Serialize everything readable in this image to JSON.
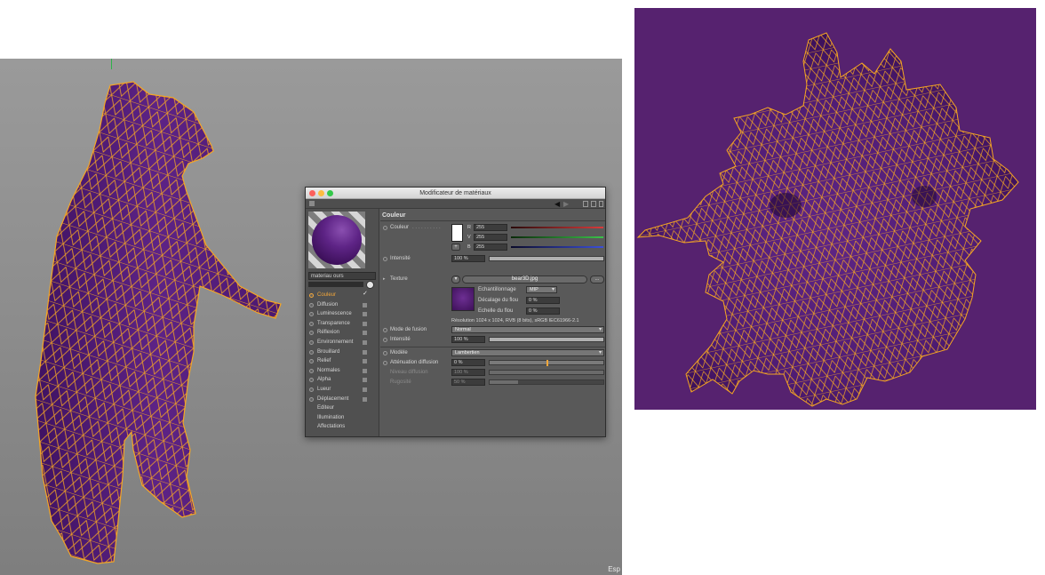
{
  "viewport": {
    "corner_label": "Esp"
  },
  "material_editor": {
    "title": "Modificateur de matériaux",
    "material_name": "materiau ours",
    "channels": [
      {
        "label": "Couleur",
        "active": true,
        "enabled": true
      },
      {
        "label": "Diffusion",
        "active": false,
        "enabled": false
      },
      {
        "label": "Luminescence",
        "active": false,
        "enabled": false
      },
      {
        "label": "Transparence",
        "active": false,
        "enabled": false
      },
      {
        "label": "Réflexion",
        "active": false,
        "enabled": false
      },
      {
        "label": "Environnement",
        "active": false,
        "enabled": false
      },
      {
        "label": "Brouillard",
        "active": false,
        "enabled": false
      },
      {
        "label": "Relief",
        "active": false,
        "enabled": false
      },
      {
        "label": "Normales",
        "active": false,
        "enabled": false
      },
      {
        "label": "Alpha",
        "active": false,
        "enabled": false
      },
      {
        "label": "Lueur",
        "active": false,
        "enabled": false
      },
      {
        "label": "Déplacement",
        "active": false,
        "enabled": false
      }
    ],
    "extra_items": [
      "Editeur",
      "Illumination",
      "Affectations"
    ],
    "section_title": "Couleur",
    "color": {
      "label": "Couleur",
      "swatch": "#ffffff",
      "r_label": "R",
      "r_value": "255",
      "g_label": "V",
      "g_value": "255",
      "b_label": "B",
      "b_value": "255"
    },
    "intensity": {
      "label": "Intensité",
      "value": "100 %",
      "fraction": 1.0
    },
    "texture": {
      "label": "Texture",
      "file": "bear3D.jpg",
      "more_button": "...",
      "sampling_label": "Echantillonnage",
      "sampling_value": "MIP",
      "blur_offset_label": "Décalage du flou",
      "blur_offset_value": "0 %",
      "blur_scale_label": "Echelle du flou",
      "blur_scale_value": "0 %",
      "resolution": "Résolution 1024 x 1024, RVB (8 bits), sRGB IEC61966-2.1"
    },
    "blend": {
      "mode_label": "Mode de fusion",
      "mode_value": "Normal",
      "intensity_label": "Intensité",
      "intensity_value": "100 %",
      "intensity_fraction": 1.0
    },
    "shading": {
      "model_label": "Modèle",
      "model_value": "Lambertien",
      "diffuse_falloff_label": "Atténuation diffusion",
      "diffuse_falloff_value": "0 %",
      "diffuse_falloff_fraction": 0.5,
      "diffuse_level_label": "Niveau diffusion",
      "diffuse_level_value": "100 %",
      "roughness_label": "Rugosité",
      "roughness_value": "50 %",
      "roughness_fraction": 0.25
    }
  },
  "colors": {
    "accent_orange": "#f3a73a",
    "mesh_purple": "#56226f",
    "wire_orange": "#f5a623",
    "red_channel": "#d93b3b",
    "green_channel": "#3bc24a",
    "blue_channel": "#3b4fd9"
  }
}
